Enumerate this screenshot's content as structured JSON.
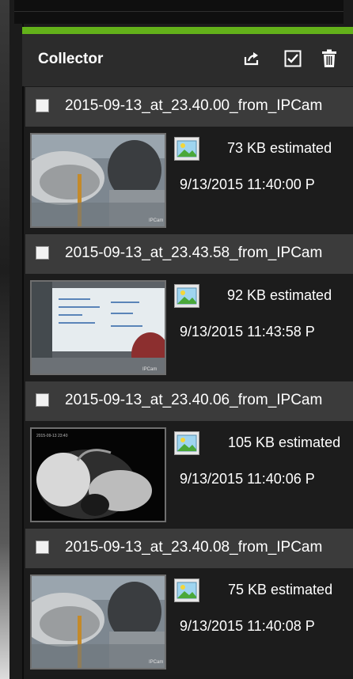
{
  "panel": {
    "title": "Collector",
    "accent": "#63b11a",
    "toolbar": [
      {
        "icon": "export-icon"
      },
      {
        "icon": "select-all-checkbox-icon"
      },
      {
        "icon": "trash-icon"
      }
    ]
  },
  "items": [
    {
      "filename": "2015-09-13_at_23.40.00_from_IPCam",
      "size": "73 KB estimated",
      "date": "9/13/2015 11:40:00 P",
      "checked": false,
      "thumbnail": "room-chair"
    },
    {
      "filename": "2015-09-13_at_23.43.58_from_IPCam",
      "size": "92 KB estimated",
      "date": "9/13/2015 11:43:58 P",
      "checked": false,
      "thumbnail": "whiteboard"
    },
    {
      "filename": "2015-09-13_at_23.40.06_from_IPCam",
      "size": "105 KB estimated",
      "date": "9/13/2015 11:40:06 P",
      "checked": false,
      "thumbnail": "night-vision"
    },
    {
      "filename": "2015-09-13_at_23.40.08_from_IPCam",
      "size": "75 KB estimated",
      "date": "9/13/2015 11:40:08 P",
      "checked": false,
      "thumbnail": "room-chair"
    }
  ]
}
